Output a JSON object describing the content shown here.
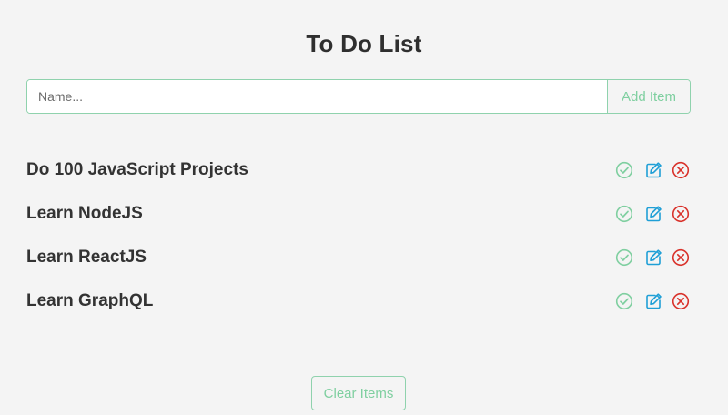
{
  "page": {
    "title": "To Do List"
  },
  "add_form": {
    "placeholder": "Name...",
    "value": "",
    "button_label": "Add Item"
  },
  "todos": [
    {
      "text": "Do 100 JavaScript Projects"
    },
    {
      "text": "Learn NodeJS"
    },
    {
      "text": "Learn ReactJS"
    },
    {
      "text": "Learn GraphQL"
    }
  ],
  "item_actions": [
    {
      "icon": "check-circle-icon",
      "color": "#7fcfa0"
    },
    {
      "icon": "edit-icon",
      "color": "#1f9fd6"
    },
    {
      "icon": "close-circle-icon",
      "color": "#d9322b"
    }
  ],
  "footer": {
    "clear_label": "Clear Items"
  },
  "colors": {
    "accent": "#7fcfa0",
    "border": "#8fd2ad",
    "background": "#f4f4f4",
    "edit": "#1f9fd6",
    "delete": "#d9322b"
  }
}
